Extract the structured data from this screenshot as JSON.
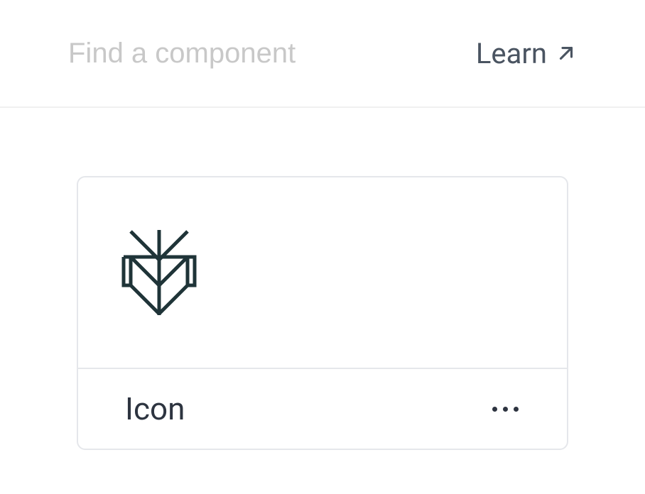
{
  "header": {
    "search_placeholder": "Find a component",
    "learn_link_label": "Learn"
  },
  "component_card": {
    "label": "Icon",
    "icon_name": "perplexity-icon"
  }
}
